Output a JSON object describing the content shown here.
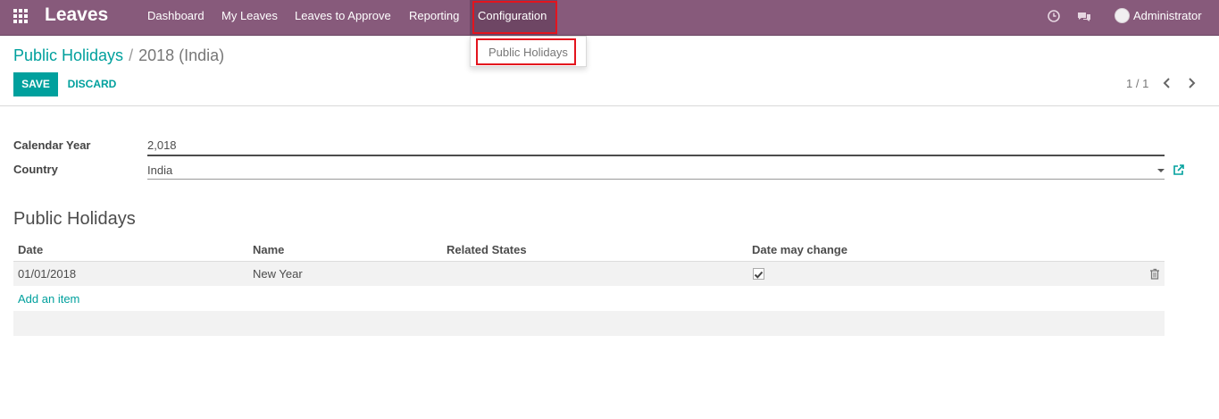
{
  "app": {
    "brand": "Leaves",
    "menu": [
      {
        "label": "Dashboard"
      },
      {
        "label": "My Leaves"
      },
      {
        "label": "Leaves to Approve"
      },
      {
        "label": "Reporting"
      },
      {
        "label": "Configuration"
      }
    ],
    "user": "Administrator",
    "dropdown_item": "Public Holidays",
    "accent_color": "#875A7B",
    "link_color": "#00A09D",
    "highlight_color": "#e3141e"
  },
  "breadcrumb": {
    "parent": "Public Holidays",
    "separator": "/",
    "current": "2018 (India)"
  },
  "buttons": {
    "save": "SAVE",
    "discard": "DISCARD"
  },
  "pager": {
    "value": "1 / 1"
  },
  "form": {
    "calendar_year_label": "Calendar Year",
    "calendar_year_value": "2,018",
    "country_label": "Country",
    "country_value": "India"
  },
  "section": {
    "title": "Public Holidays"
  },
  "table": {
    "headers": [
      "Date",
      "Name",
      "Related States",
      "Date may change"
    ],
    "rows": [
      {
        "date": "01/01/2018",
        "name": "New Year",
        "related_states": "",
        "date_may_change": true
      }
    ],
    "add_item": "Add an item"
  }
}
